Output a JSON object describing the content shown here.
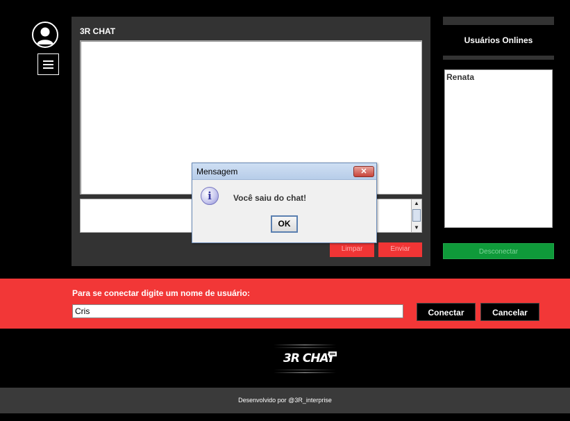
{
  "sidebar": {
    "avatar_icon": "user-avatar-icon",
    "menu_icon": "hamburger-menu-icon"
  },
  "chat": {
    "title": "3R CHAT",
    "clear_label": "Limpar",
    "send_label": "Enviar"
  },
  "users": {
    "header": "Usuários Onlines",
    "list": [
      "Renata"
    ],
    "disconnect_label": "Desconectar"
  },
  "connect": {
    "prompt": "Para se conectar digite um nome de usuário:",
    "username_value": "Cris",
    "connect_label": "Conectar",
    "cancel_label": "Cancelar"
  },
  "logo": {
    "text": "3R CHAT"
  },
  "footer": {
    "credit": "Desenvolvido por @3R_interprise"
  },
  "dialog": {
    "title": "Mensagem",
    "close_glyph": "✕",
    "icon_glyph": "i",
    "message": "Você saiu do chat!",
    "ok_label": "OK"
  },
  "colors": {
    "accent_red": "#f23737",
    "disconnect_green": "#0f9a3a",
    "panel_gray": "#333333"
  }
}
